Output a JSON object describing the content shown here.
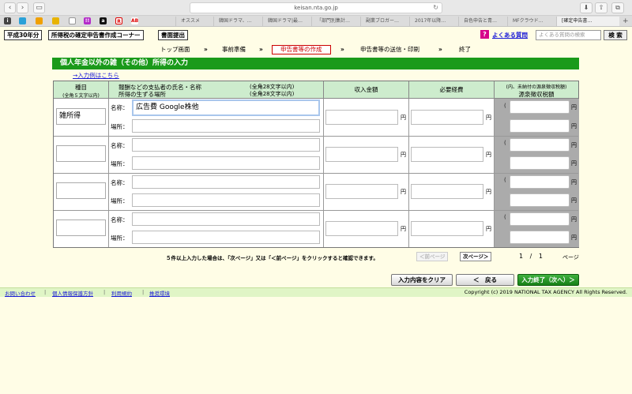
{
  "browser": {
    "url": "keisan.nta.go.jp",
    "tabs": [
      "オススメ",
      "韓国ドラマ、…",
      "韓国ドラマ|最…",
      "「部門別集計…",
      "副業ブロガー…",
      "2017年以降…",
      "自色申告と青…",
      "MFクラウド…",
      "[確定申告書…"
    ],
    "favicon_labels": [
      "",
      "",
      "",
      "",
      "!!",
      "a",
      "R",
      "AB"
    ]
  },
  "header": {
    "year_badge": "平成30年分",
    "app_title": "所得税の確定申告書作成コーナー",
    "submit_badge": "書面提出",
    "faq_icon": "?",
    "faq_link": "よくある質問",
    "faq_placeholder": "よくある質問の検索",
    "search_button": "検 索"
  },
  "steps": {
    "items": [
      "トップ画面",
      "事前準備",
      "申告書等の作成",
      "申告書等の送信・印刷",
      "終了"
    ],
    "active": "申告書等の作成",
    "separator": "»"
  },
  "section": {
    "title": "個人年金以外の雑（その他）所得の入力",
    "example_link": "→入力例はこちら"
  },
  "table": {
    "headers": {
      "kind": "種目",
      "kind_note": "(全角５文字以内)",
      "payer_line1": "報酬などの支払者の氏名・名称",
      "payer_line1_note": "(全角28文字以内)",
      "payer_line2": "所得の生ずる場所",
      "payer_line2_note": "(全角28文字以内)",
      "income": "収入金額",
      "expenses": "必要経費",
      "withholding_note": "(内、未納付の源泉徴収税額)",
      "withholding": "源泉徴収税額"
    },
    "name_label": "名称：",
    "place_label": "場所：",
    "yen": "円",
    "open_paren": "(",
    "rows": [
      {
        "kind": "雑所得",
        "name": "広告費 Google株他",
        "place": ""
      },
      {
        "kind": "",
        "name": "",
        "place": ""
      },
      {
        "kind": "",
        "name": "",
        "place": ""
      },
      {
        "kind": "",
        "name": "",
        "place": ""
      }
    ]
  },
  "pagination": {
    "notice": "５件以上入力した場合は、「次ページ」又は「＜前ページ」をクリックすると確認できます。",
    "prev_button": "＜前ページ",
    "next_button": "次ページ＞",
    "current": "1",
    "total": "1",
    "separator": "/",
    "page_label": "ページ"
  },
  "actions": {
    "clear": "入力内容をクリア",
    "back": "＜　戻る",
    "done": "入力終了（次へ）＞"
  },
  "footer": {
    "links": [
      "お問い合わせ",
      "個人情報保護方針",
      "利用規約",
      "推奨環境"
    ],
    "copyright": "Copyright (c) 2019 NATIONAL TAX AGENCY All Rights Reserved."
  },
  "colors": {
    "green": "#1a9a1a",
    "header_green_light": "#cdeccd",
    "page_background": "#fffde6",
    "link_blue": "#1a1ad6",
    "active_step_red": "#c00000"
  }
}
